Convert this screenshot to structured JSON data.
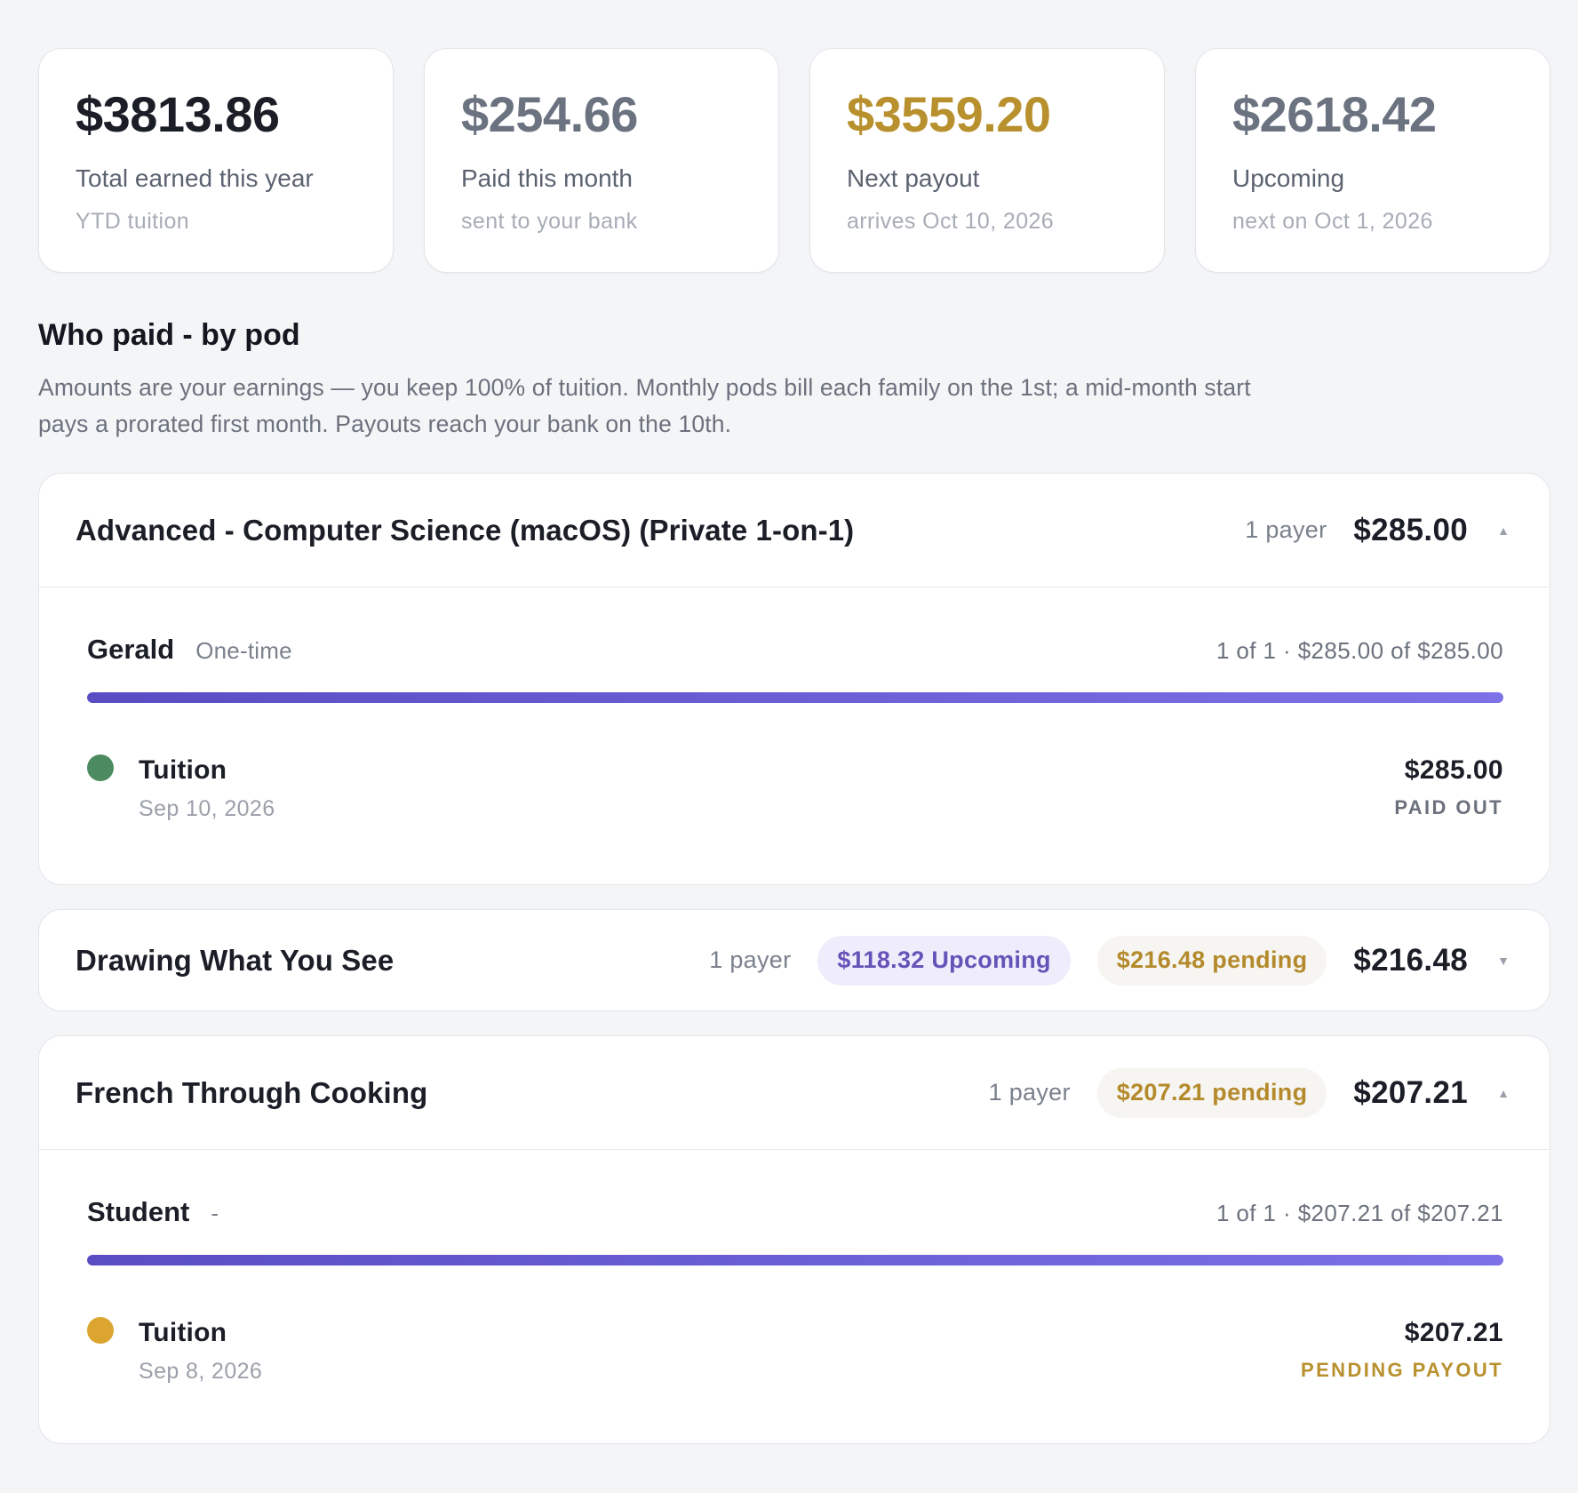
{
  "colors": {
    "primary_text": "#1b1e27",
    "muted_value": "#6b7280",
    "gold": "#b8902d",
    "accent_purple": "#5a4dc4",
    "dot_paid": "#4b8b5f",
    "dot_pending": "#dba530"
  },
  "stats": [
    {
      "value": "$3813.86",
      "label": "Total earned this year",
      "sub": "YTD tuition",
      "color": "#1b1e27"
    },
    {
      "value": "$254.66",
      "label": "Paid this month",
      "sub": "sent to your bank",
      "color": "#6b7280"
    },
    {
      "value": "$3559.20",
      "label": "Next payout",
      "sub": "arrives Oct 10, 2026",
      "color": "#b8902d"
    },
    {
      "value": "$2618.42",
      "label": "Upcoming",
      "sub": "next on Oct 1, 2026",
      "color": "#6b7280"
    }
  ],
  "section": {
    "title": "Who paid - by pod",
    "description": "Amounts are your earnings — you keep 100% of tuition. Monthly pods bill each family on the 1st; a mid-month start pays a prorated first month. Payouts reach your bank on the 10th."
  },
  "pods": [
    {
      "title": "Advanced - Computer Science (macOS) (Private 1-on-1)",
      "payers_text": "1 payer",
      "total": "$285.00",
      "caret_icon": "caret-up-icon",
      "caret": "▲",
      "payer": {
        "name": "Gerald",
        "plan": "One-time",
        "progress_text": "1 of 1 · $285.00 of $285.00",
        "progress_fraction": 1.0,
        "item": {
          "name": "Tuition",
          "date": "Sep 10, 2026",
          "amount": "$285.00",
          "status": "PAID OUT",
          "status_color": "#6b717d",
          "dot_color": "#4b8b5f"
        }
      }
    },
    {
      "title": "Drawing What You See",
      "payers_text": "1 payer",
      "upcoming_pill": "$118.32 Upcoming",
      "pending_pill": "$216.48 pending",
      "total": "$216.48",
      "caret_icon": "caret-down-icon",
      "caret": "▼"
    },
    {
      "title": "French Through Cooking",
      "payers_text": "1 payer",
      "pending_pill": "$207.21 pending",
      "total": "$207.21",
      "caret_icon": "caret-up-icon",
      "caret": "▲",
      "payer": {
        "name": "Student",
        "plan": "-",
        "progress_text": "1 of 1 · $207.21 of $207.21",
        "progress_fraction": 1.0,
        "item": {
          "name": "Tuition",
          "date": "Sep 8, 2026",
          "amount": "$207.21",
          "status": "PENDING PAYOUT",
          "status_color": "#b8902d",
          "dot_color": "#dba530"
        }
      }
    }
  ]
}
